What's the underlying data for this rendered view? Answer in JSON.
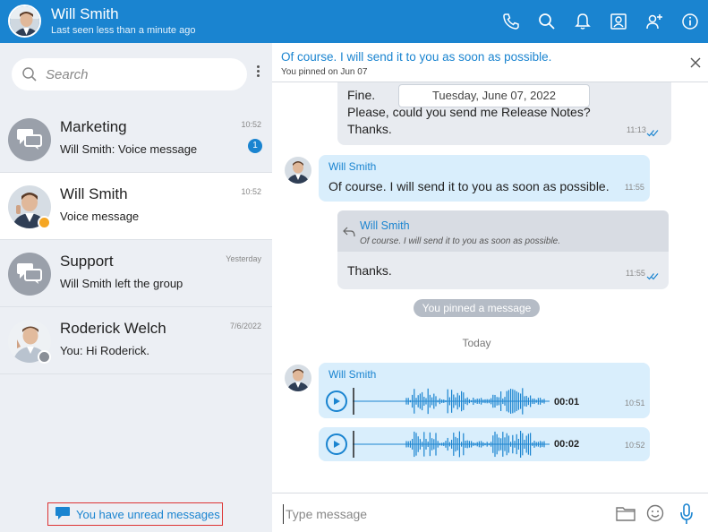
{
  "header": {
    "name": "Will Smith",
    "status": "Last seen less than a minute ago",
    "icons": [
      "phone-icon",
      "search-icon",
      "bell-icon",
      "contact-card-icon",
      "add-user-icon",
      "info-icon"
    ]
  },
  "sidebar": {
    "search_placeholder": "Search",
    "conversations": [
      {
        "title": "Marketing",
        "message": "Will Smith: Voice message",
        "time": "10:52",
        "badge": "1",
        "avatar": "group-chat-icon"
      },
      {
        "title": "Will Smith",
        "message": "Voice message",
        "time": "10:52",
        "avatar": "person-photo",
        "status": "away"
      },
      {
        "title": "Support",
        "message": "Will Smith left the group",
        "time": "Yesterday",
        "avatar": "group-chat-icon"
      },
      {
        "title": "Roderick Welch",
        "message": "You: Hi Roderick.",
        "time": "7/6/2022",
        "avatar": "person-photo",
        "status": "offline"
      }
    ],
    "unread_link": "You have unread messages"
  },
  "pinned": {
    "text": "Of course. I will send it to you as soon as possible.",
    "meta": "You pinned on Jun 07"
  },
  "chat": {
    "date_chip": "Tuesday, June 07, 2022",
    "msg1": {
      "lines": [
        "Fine.",
        "Please, could you send me Release Notes?",
        "Thanks."
      ],
      "time": "11:13"
    },
    "msg2": {
      "sender": "Will Smith",
      "text": "Of course. I will send it to you as soon as possible.",
      "time": "11:55"
    },
    "msg3": {
      "quote_sender": "Will Smith",
      "quote_text": "Of course. I will send it to you as soon as possible.",
      "text": "Thanks.",
      "time": "11:55"
    },
    "system": "You pinned a message",
    "today": "Today",
    "voice": {
      "sender": "Will Smith",
      "items": [
        {
          "duration": "00:01",
          "time": "10:51"
        },
        {
          "duration": "00:02",
          "time": "10:52"
        }
      ]
    }
  },
  "composer": {
    "placeholder": "Type message"
  },
  "colors": {
    "accent": "#1a84d0",
    "sidebar_bg": "#eceff4",
    "bubble_in": "#d9eefc",
    "bubble_out": "#e8ebf0",
    "away": "#f5a623",
    "offline": "#8a8f97"
  }
}
